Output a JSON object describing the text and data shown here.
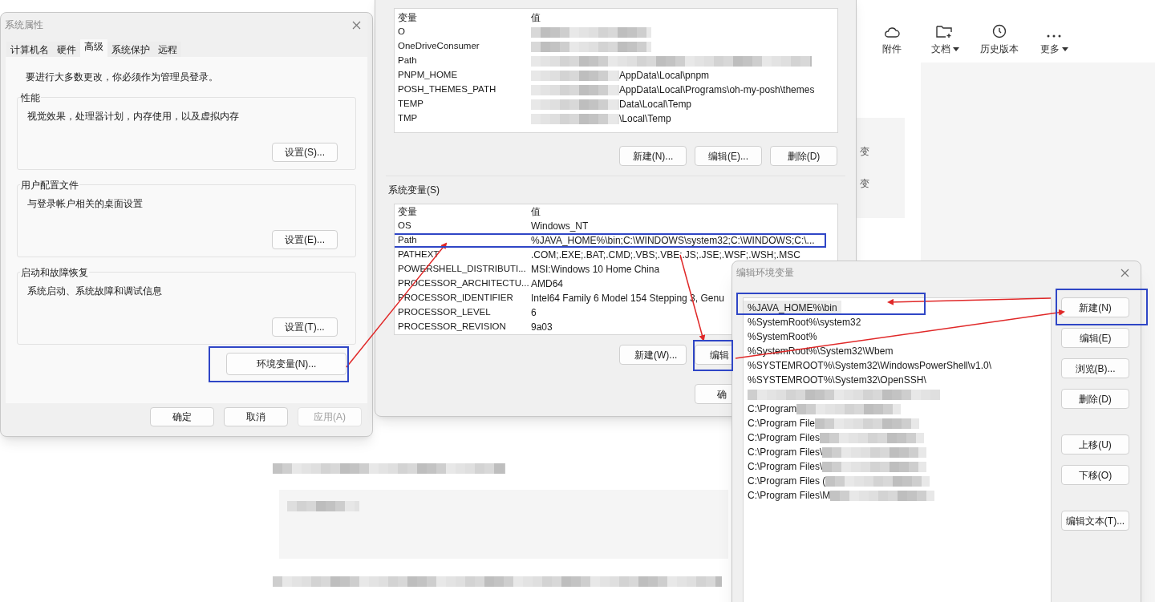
{
  "background_page": {
    "toolbar": [
      {
        "kind": "cloud",
        "label": "附件",
        "dropdown": false
      },
      {
        "kind": "folder",
        "label": "文档",
        "dropdown": true
      },
      {
        "kind": "clock",
        "label": "历史版本",
        "dropdown": false
      },
      {
        "kind": "dots",
        "label": "更多",
        "dropdown": true
      }
    ],
    "side_texts": [
      "变",
      "变"
    ]
  },
  "system_properties": {
    "title": "系统属性",
    "tabs": [
      {
        "label": "计算机名",
        "selected": false
      },
      {
        "label": "硬件",
        "selected": false
      },
      {
        "label": "高级",
        "selected": true
      },
      {
        "label": "系统保护",
        "selected": false
      },
      {
        "label": "远程",
        "selected": false
      }
    ],
    "notice": "要进行大多数更改，你必须作为管理员登录。",
    "groups": [
      {
        "title": "性能",
        "description": "视觉效果，处理器计划，内存使用，以及虚拟内存",
        "button": "设置(S)..."
      },
      {
        "title": "用户配置文件",
        "description": "与登录帐户相关的桌面设置",
        "button": "设置(E)..."
      },
      {
        "title": "启动和故障恢复",
        "description": "系统启动、系统故障和调试信息",
        "button": "设置(T)..."
      }
    ],
    "env_button": {
      "label": "环境变量(N)...",
      "highlighted": true
    },
    "buttons": [
      {
        "label": "确定",
        "disabled": false
      },
      {
        "label": "取消",
        "disabled": false
      },
      {
        "label": "应用(A)",
        "disabled": true
      }
    ]
  },
  "environment_variables": {
    "user_table": {
      "columns": [
        "变量",
        "值"
      ],
      "rows": [
        {
          "name": "O",
          "redacted": true
        },
        {
          "name": "OneDriveConsumer",
          "redacted": true
        },
        {
          "name": "Path",
          "redacted": true
        },
        {
          "name": "PNPM_HOME",
          "value": "AppData\\Local\\pnpm",
          "redacted": true
        },
        {
          "name": "POSH_THEMES_PATH",
          "value": "AppData\\Local\\Programs\\oh-my-posh\\themes",
          "redacted": true
        },
        {
          "name": "TEMP",
          "value": "Data\\Local\\Temp",
          "redacted": true
        },
        {
          "name": "TMP",
          "value": "\\Local\\Temp",
          "redacted": true
        }
      ]
    },
    "user_buttons": [
      "新建(N)...",
      "编辑(E)...",
      "删除(D)"
    ],
    "system_section_label": "系统变量(S)",
    "system_table": {
      "columns": [
        "变量",
        "值"
      ],
      "rows": [
        {
          "name": "OS",
          "value": "Windows_NT",
          "highlighted": false
        },
        {
          "name": "Path",
          "value": "%JAVA_HOME%\\bin;C:\\WINDOWS\\system32;C:\\WINDOWS;C:\\...",
          "highlighted": true
        },
        {
          "name": "PATHEXT",
          "value": ".COM;.EXE;.BAT;.CMD;.VBS;.VBE;.JS;.JSE;.WSF;.WSH;.MSC",
          "highlighted": false
        },
        {
          "name": "POWERSHELL_DISTRIBUTI...",
          "value": "MSI:Windows 10 Home China",
          "highlighted": false
        },
        {
          "name": "PROCESSOR_ARCHITECTU...",
          "value": "AMD64",
          "highlighted": false
        },
        {
          "name": "PROCESSOR_IDENTIFIER",
          "value": "Intel64 Family 6 Model 154 Stepping 3, Genu",
          "highlighted": false
        },
        {
          "name": "PROCESSOR_LEVEL",
          "value": "6",
          "highlighted": false
        },
        {
          "name": "PROCESSOR_REVISION",
          "value": "9a03",
          "highlighted": false
        }
      ]
    },
    "system_buttons": [
      {
        "label": "新建(W)...",
        "highlighted": false
      },
      {
        "label": "编辑",
        "highlighted": true
      }
    ],
    "ok_button": "确"
  },
  "edit_window": {
    "title": "编辑环境变量",
    "items": [
      {
        "text": "%JAVA_HOME%\\bin",
        "selected": true,
        "highlighted": true,
        "redacted": false
      },
      {
        "text": "%SystemRoot%\\system32",
        "selected": false,
        "highlighted": false,
        "redacted": false
      },
      {
        "text": "%SystemRoot%",
        "selected": false,
        "highlighted": false,
        "redacted": false
      },
      {
        "text": "%SystemRoot%\\System32\\Wbem",
        "selected": false,
        "highlighted": false,
        "redacted": false
      },
      {
        "text": "%SYSTEMROOT%\\System32\\WindowsPowerShell\\v1.0\\",
        "selected": false,
        "highlighted": false,
        "redacted": false
      },
      {
        "text": "%SYSTEMROOT%\\System32\\OpenSSH\\",
        "selected": false,
        "highlighted": false,
        "redacted": false
      },
      {
        "selected": false,
        "highlighted": false,
        "redacted": true
      },
      {
        "text": "C:\\Program",
        "selected": false,
        "highlighted": false,
        "redacted": true
      },
      {
        "text": "C:\\Program File",
        "selected": false,
        "highlighted": false,
        "redacted": true
      },
      {
        "text": "C:\\Program Files",
        "selected": false,
        "highlighted": false,
        "redacted": true
      },
      {
        "text": "C:\\Program Files\\",
        "selected": false,
        "highlighted": false,
        "redacted": true
      },
      {
        "text": "C:\\Program Files\\",
        "selected": false,
        "highlighted": false,
        "redacted": true
      },
      {
        "text": "C:\\Program Files (",
        "selected": false,
        "highlighted": false,
        "redacted": true
      },
      {
        "text": "C:\\Program Files\\M",
        "selected": false,
        "highlighted": false,
        "redacted": true
      }
    ],
    "buttons": [
      {
        "label": "新建(N)",
        "highlighted": true
      },
      {
        "label": "编辑(E)",
        "highlighted": false
      },
      {
        "label": "浏览(B)...",
        "highlighted": false
      },
      {
        "label": "删除(D)",
        "highlighted": false
      },
      {
        "label": "上移(U)",
        "highlighted": false
      },
      {
        "label": "下移(O)",
        "highlighted": false
      },
      {
        "label": "编辑文本(T)...",
        "highlighted": false
      }
    ]
  }
}
